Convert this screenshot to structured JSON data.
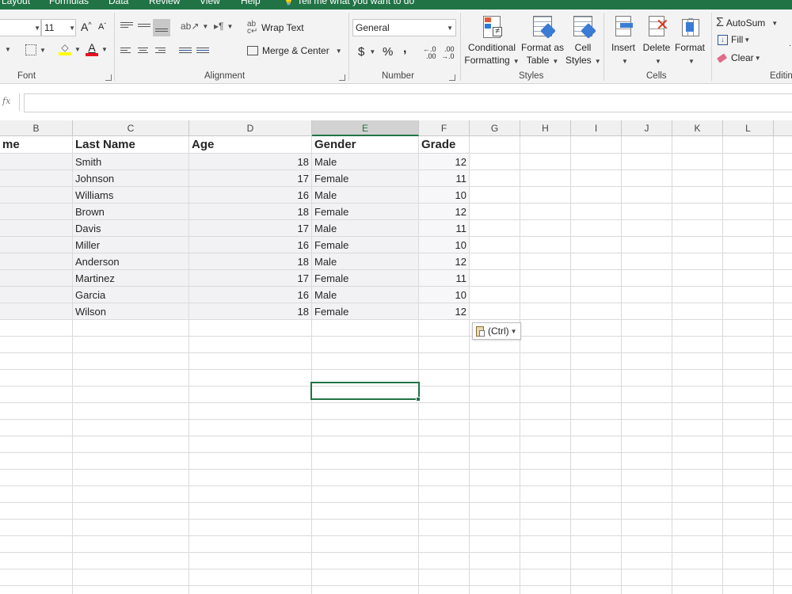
{
  "tabs": [
    {
      "label": "Layout"
    },
    {
      "label": "Formulas"
    },
    {
      "label": "Data"
    },
    {
      "label": "Review"
    },
    {
      "label": "View"
    },
    {
      "label": "Help"
    },
    {
      "label": "Tell me what you want to do"
    }
  ],
  "ribbon": {
    "font": {
      "group_label": "Font",
      "size_value": "11",
      "grow_label": "A",
      "shrink_label": "A",
      "font_color_label": "A",
      "font_color": "#e81123",
      "highlight_color": "#ffff00"
    },
    "alignment": {
      "group_label": "Alignment",
      "wrap_text_label": "Wrap Text",
      "merge_center_label": "Merge & Center"
    },
    "number": {
      "group_label": "Number",
      "format_value": "General",
      "currency_label": "$",
      "percent_label": "%",
      "comma_label": ",",
      "inc_decimal_label": ".00",
      "dec_decimal_label": ".00"
    },
    "styles": {
      "group_label": "Styles",
      "conditional_formatting_line1": "Conditional",
      "conditional_formatting_line2": "Formatting",
      "format_as_table_line1": "Format as",
      "format_as_table_line2": "Table",
      "cell_styles_line1": "Cell",
      "cell_styles_line2": "Styles"
    },
    "cells": {
      "group_label": "Cells",
      "insert_label": "Insert",
      "delete_label": "Delete",
      "format_label": "Format"
    },
    "editing": {
      "group_label": "Editin",
      "autosum_label": "AutoSum",
      "fill_label": "Fill",
      "clear_label": "Clear"
    }
  },
  "formula_bar": {
    "fx_label": "fx",
    "value": ""
  },
  "columns": [
    "B",
    "C",
    "D",
    "E",
    "F",
    "G",
    "H",
    "I",
    "J",
    "K",
    "L"
  ],
  "selected_column": "E",
  "sheet": {
    "headers": [
      "me",
      "Last Name",
      "Age",
      "Gender",
      "Grade"
    ],
    "rows": [
      {
        "last": "Smith",
        "age": "18",
        "gender": "Male",
        "grade": "12"
      },
      {
        "last": "Johnson",
        "age": "17",
        "gender": "Female",
        "grade": "11"
      },
      {
        "last": "Williams",
        "age": "16",
        "gender": "Male",
        "grade": "10"
      },
      {
        "last": "Brown",
        "age": "18",
        "gender": "Female",
        "grade": "12"
      },
      {
        "last": "Davis",
        "age": "17",
        "gender": "Male",
        "grade": "11"
      },
      {
        "last": "Miller",
        "age": "16",
        "gender": "Female",
        "grade": "10"
      },
      {
        "last": "Anderson",
        "age": "18",
        "gender": "Male",
        "grade": "12"
      },
      {
        "last": "Martinez",
        "age": "17",
        "gender": "Female",
        "grade": "11"
      },
      {
        "last": "Garcia",
        "age": "16",
        "gender": "Male",
        "grade": "10"
      },
      {
        "last": "Wilson",
        "age": "18",
        "gender": "Female",
        "grade": "12"
      }
    ]
  },
  "paste_options_label": "(Ctrl)",
  "accent_color": "#217346"
}
